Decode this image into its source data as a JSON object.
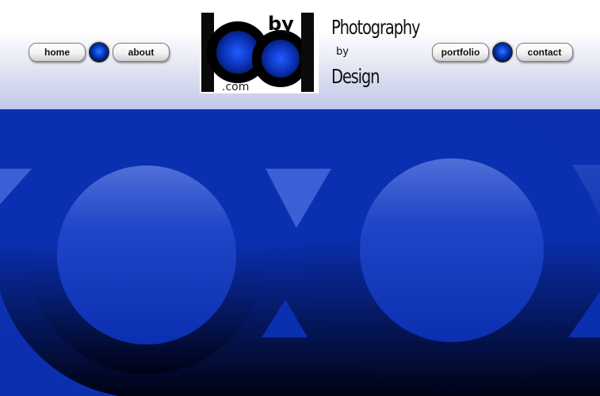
{
  "nav": {
    "left": [
      {
        "label": "home"
      },
      {
        "label": "about"
      }
    ],
    "right": [
      {
        "label": "portfolio"
      },
      {
        "label": "contact"
      }
    ]
  },
  "logo": {
    "mark_top": "by",
    "mark_bottom": ".com"
  },
  "brand": {
    "line1": "Photography",
    "line2": "by",
    "line3": "Design"
  },
  "colors": {
    "primary_blue": "#0b2fb0",
    "dark_navy": "#00062a",
    "header_gradient_end": "#c0c6e8"
  },
  "icons": [
    "nav-orb-icon"
  ]
}
